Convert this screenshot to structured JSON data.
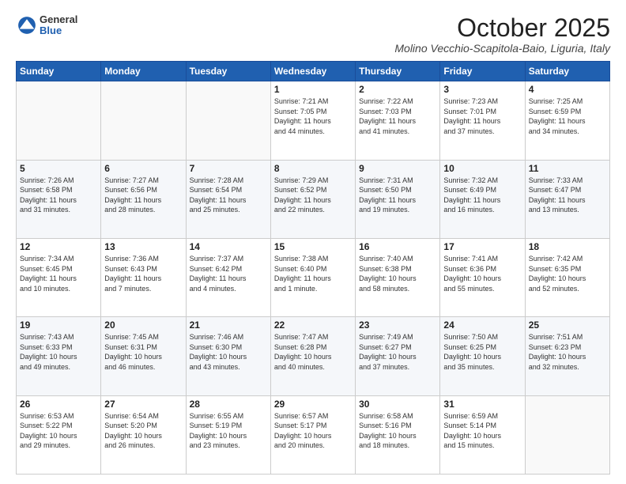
{
  "header": {
    "logo_general": "General",
    "logo_blue": "Blue",
    "month": "October 2025",
    "location": "Molino Vecchio-Scapitola-Baio, Liguria, Italy"
  },
  "weekdays": [
    "Sunday",
    "Monday",
    "Tuesday",
    "Wednesday",
    "Thursday",
    "Friday",
    "Saturday"
  ],
  "weeks": [
    [
      {
        "day": "",
        "info": ""
      },
      {
        "day": "",
        "info": ""
      },
      {
        "day": "",
        "info": ""
      },
      {
        "day": "1",
        "info": "Sunrise: 7:21 AM\nSunset: 7:05 PM\nDaylight: 11 hours\nand 44 minutes."
      },
      {
        "day": "2",
        "info": "Sunrise: 7:22 AM\nSunset: 7:03 PM\nDaylight: 11 hours\nand 41 minutes."
      },
      {
        "day": "3",
        "info": "Sunrise: 7:23 AM\nSunset: 7:01 PM\nDaylight: 11 hours\nand 37 minutes."
      },
      {
        "day": "4",
        "info": "Sunrise: 7:25 AM\nSunset: 6:59 PM\nDaylight: 11 hours\nand 34 minutes."
      }
    ],
    [
      {
        "day": "5",
        "info": "Sunrise: 7:26 AM\nSunset: 6:58 PM\nDaylight: 11 hours\nand 31 minutes."
      },
      {
        "day": "6",
        "info": "Sunrise: 7:27 AM\nSunset: 6:56 PM\nDaylight: 11 hours\nand 28 minutes."
      },
      {
        "day": "7",
        "info": "Sunrise: 7:28 AM\nSunset: 6:54 PM\nDaylight: 11 hours\nand 25 minutes."
      },
      {
        "day": "8",
        "info": "Sunrise: 7:29 AM\nSunset: 6:52 PM\nDaylight: 11 hours\nand 22 minutes."
      },
      {
        "day": "9",
        "info": "Sunrise: 7:31 AM\nSunset: 6:50 PM\nDaylight: 11 hours\nand 19 minutes."
      },
      {
        "day": "10",
        "info": "Sunrise: 7:32 AM\nSunset: 6:49 PM\nDaylight: 11 hours\nand 16 minutes."
      },
      {
        "day": "11",
        "info": "Sunrise: 7:33 AM\nSunset: 6:47 PM\nDaylight: 11 hours\nand 13 minutes."
      }
    ],
    [
      {
        "day": "12",
        "info": "Sunrise: 7:34 AM\nSunset: 6:45 PM\nDaylight: 11 hours\nand 10 minutes."
      },
      {
        "day": "13",
        "info": "Sunrise: 7:36 AM\nSunset: 6:43 PM\nDaylight: 11 hours\nand 7 minutes."
      },
      {
        "day": "14",
        "info": "Sunrise: 7:37 AM\nSunset: 6:42 PM\nDaylight: 11 hours\nand 4 minutes."
      },
      {
        "day": "15",
        "info": "Sunrise: 7:38 AM\nSunset: 6:40 PM\nDaylight: 11 hours\nand 1 minute."
      },
      {
        "day": "16",
        "info": "Sunrise: 7:40 AM\nSunset: 6:38 PM\nDaylight: 10 hours\nand 58 minutes."
      },
      {
        "day": "17",
        "info": "Sunrise: 7:41 AM\nSunset: 6:36 PM\nDaylight: 10 hours\nand 55 minutes."
      },
      {
        "day": "18",
        "info": "Sunrise: 7:42 AM\nSunset: 6:35 PM\nDaylight: 10 hours\nand 52 minutes."
      }
    ],
    [
      {
        "day": "19",
        "info": "Sunrise: 7:43 AM\nSunset: 6:33 PM\nDaylight: 10 hours\nand 49 minutes."
      },
      {
        "day": "20",
        "info": "Sunrise: 7:45 AM\nSunset: 6:31 PM\nDaylight: 10 hours\nand 46 minutes."
      },
      {
        "day": "21",
        "info": "Sunrise: 7:46 AM\nSunset: 6:30 PM\nDaylight: 10 hours\nand 43 minutes."
      },
      {
        "day": "22",
        "info": "Sunrise: 7:47 AM\nSunset: 6:28 PM\nDaylight: 10 hours\nand 40 minutes."
      },
      {
        "day": "23",
        "info": "Sunrise: 7:49 AM\nSunset: 6:27 PM\nDaylight: 10 hours\nand 37 minutes."
      },
      {
        "day": "24",
        "info": "Sunrise: 7:50 AM\nSunset: 6:25 PM\nDaylight: 10 hours\nand 35 minutes."
      },
      {
        "day": "25",
        "info": "Sunrise: 7:51 AM\nSunset: 6:23 PM\nDaylight: 10 hours\nand 32 minutes."
      }
    ],
    [
      {
        "day": "26",
        "info": "Sunrise: 6:53 AM\nSunset: 5:22 PM\nDaylight: 10 hours\nand 29 minutes."
      },
      {
        "day": "27",
        "info": "Sunrise: 6:54 AM\nSunset: 5:20 PM\nDaylight: 10 hours\nand 26 minutes."
      },
      {
        "day": "28",
        "info": "Sunrise: 6:55 AM\nSunset: 5:19 PM\nDaylight: 10 hours\nand 23 minutes."
      },
      {
        "day": "29",
        "info": "Sunrise: 6:57 AM\nSunset: 5:17 PM\nDaylight: 10 hours\nand 20 minutes."
      },
      {
        "day": "30",
        "info": "Sunrise: 6:58 AM\nSunset: 5:16 PM\nDaylight: 10 hours\nand 18 minutes."
      },
      {
        "day": "31",
        "info": "Sunrise: 6:59 AM\nSunset: 5:14 PM\nDaylight: 10 hours\nand 15 minutes."
      },
      {
        "day": "",
        "info": ""
      }
    ]
  ]
}
